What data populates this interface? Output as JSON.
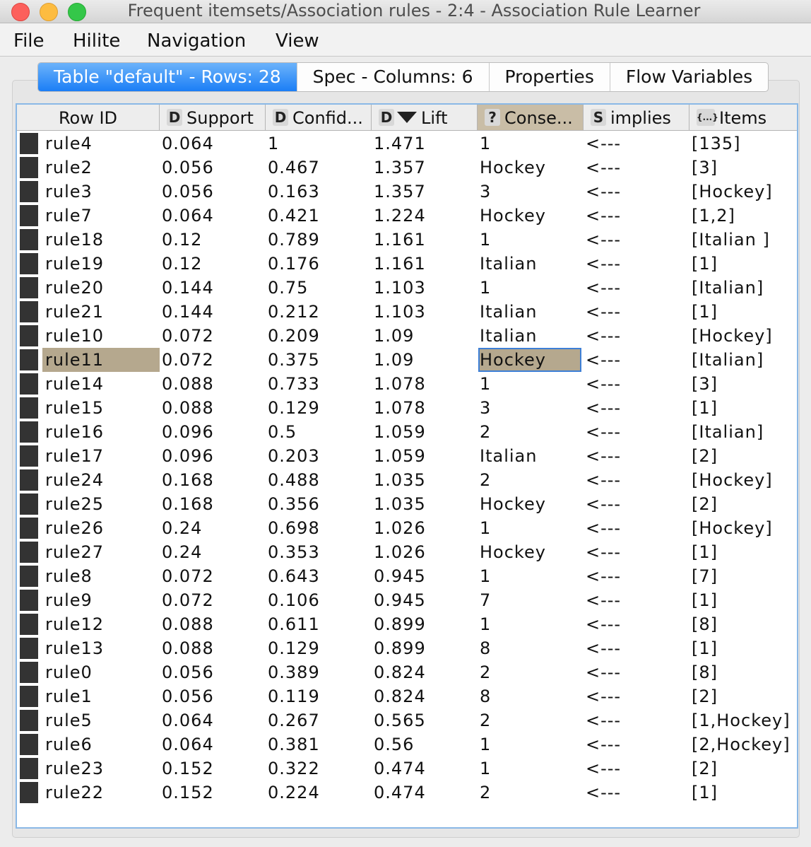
{
  "window": {
    "title": "Frequent itemsets/Association rules - 2:4 - Association Rule Learner"
  },
  "menu": [
    "File",
    "Hilite",
    "Navigation",
    "View"
  ],
  "tabs": [
    {
      "label": "Table \"default\" - Rows: 28",
      "active": true
    },
    {
      "label": "Spec - Columns: 6",
      "active": false
    },
    {
      "label": "Properties",
      "active": false
    },
    {
      "label": "Flow Variables",
      "active": false
    }
  ],
  "table": {
    "columns": [
      {
        "label": "Row ID",
        "type": ""
      },
      {
        "label": "Support",
        "type": "D"
      },
      {
        "label": "Confid...",
        "type": "D"
      },
      {
        "label": "Lift",
        "type": "D"
      },
      {
        "label": "Conse...",
        "type": "?"
      },
      {
        "label": "implies",
        "type": "S"
      },
      {
        "label": "Items",
        "type": "{...}"
      }
    ],
    "sorted_column": "Lift",
    "rows": [
      [
        "rule4",
        "0.064",
        "1",
        "1.471",
        "1",
        "<---",
        "[135]"
      ],
      [
        "rule2",
        "0.056",
        "0.467",
        "1.357",
        "Hockey",
        "<---",
        "[3]"
      ],
      [
        "rule3",
        "0.056",
        "0.163",
        "1.357",
        "3",
        "<---",
        "[Hockey]"
      ],
      [
        "rule7",
        "0.064",
        "0.421",
        "1.224",
        "Hockey",
        "<---",
        "[1,2]"
      ],
      [
        "rule18",
        "0.12",
        "0.789",
        "1.161",
        "1",
        "<---",
        "[Italian ]"
      ],
      [
        "rule19",
        "0.12",
        "0.176",
        "1.161",
        "Italian",
        "<---",
        "[1]"
      ],
      [
        "rule20",
        "0.144",
        "0.75",
        "1.103",
        "1",
        "<---",
        "[Italian]"
      ],
      [
        "rule21",
        "0.144",
        "0.212",
        "1.103",
        "Italian",
        "<---",
        "[1]"
      ],
      [
        "rule10",
        "0.072",
        "0.209",
        "1.09",
        "Italian",
        "<---",
        "[Hockey]"
      ],
      [
        "rule11",
        "0.072",
        "0.375",
        "1.09",
        "Hockey",
        "<---",
        "[Italian]"
      ],
      [
        "rule14",
        "0.088",
        "0.733",
        "1.078",
        "1",
        "<---",
        "[3]"
      ],
      [
        "rule15",
        "0.088",
        "0.129",
        "1.078",
        "3",
        "<---",
        "[1]"
      ],
      [
        "rule16",
        "0.096",
        "0.5",
        "1.059",
        "2",
        "<---",
        "[Italian]"
      ],
      [
        "rule17",
        "0.096",
        "0.203",
        "1.059",
        "Italian",
        "<---",
        "[2]"
      ],
      [
        "rule24",
        "0.168",
        "0.488",
        "1.035",
        "2",
        "<---",
        "[Hockey]"
      ],
      [
        "rule25",
        "0.168",
        "0.356",
        "1.035",
        "Hockey",
        "<---",
        "[2]"
      ],
      [
        "rule26",
        "0.24",
        "0.698",
        "1.026",
        "1",
        "<---",
        "[Hockey]"
      ],
      [
        "rule27",
        "0.24",
        "0.353",
        "1.026",
        "Hockey",
        "<---",
        "[1]"
      ],
      [
        "rule8",
        "0.072",
        "0.643",
        "0.945",
        "1",
        "<---",
        "[7]"
      ],
      [
        "rule9",
        "0.072",
        "0.106",
        "0.945",
        "7",
        "<---",
        "[1]"
      ],
      [
        "rule12",
        "0.088",
        "0.611",
        "0.899",
        "1",
        "<---",
        "[8]"
      ],
      [
        "rule13",
        "0.088",
        "0.129",
        "0.899",
        "8",
        "<---",
        "[1]"
      ],
      [
        "rule0",
        "0.056",
        "0.389",
        "0.824",
        "2",
        "<---",
        "[8]"
      ],
      [
        "rule1",
        "0.056",
        "0.119",
        "0.824",
        "8",
        "<---",
        "[2]"
      ],
      [
        "rule5",
        "0.064",
        "0.267",
        "0.565",
        "2",
        "<---",
        "[1,Hockey]"
      ],
      [
        "rule6",
        "0.064",
        "0.381",
        "0.56",
        "1",
        "<---",
        "[2,Hockey]"
      ],
      [
        "rule23",
        "0.152",
        "0.322",
        "0.474",
        "1",
        "<---",
        "[2]"
      ],
      [
        "rule22",
        "0.152",
        "0.224",
        "0.474",
        "2",
        "<---",
        "[1]"
      ]
    ],
    "selected_row": "rule11"
  }
}
